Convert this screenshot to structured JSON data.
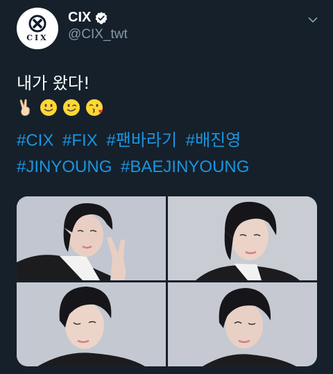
{
  "tweet": {
    "account": {
      "display_name": "CIX",
      "handle": "@CIX_twt",
      "avatar_logo_text": "CIX",
      "verified": true
    },
    "text": "내가 왔다!",
    "emojis": [
      "victory-hand",
      "slightly-smiling-face",
      "winking-face",
      "face-blowing-kiss"
    ],
    "hashtags": [
      "#CIX",
      "#FIX",
      "#팬바라기",
      "#배진영",
      "#JINYOUNG",
      "#BAEJINYOUNG"
    ],
    "photos": [
      {
        "name": "photo-top-left",
        "pose": "peace-sign"
      },
      {
        "name": "photo-top-right",
        "pose": "close-up"
      },
      {
        "name": "photo-bottom-left",
        "pose": "wink"
      },
      {
        "name": "photo-bottom-right",
        "pose": "wink-close-up"
      }
    ]
  },
  "colors": {
    "background": "#15202b",
    "link": "#1b95e0",
    "secondary_text": "#8899a6",
    "verified_badge": "#ffffff"
  }
}
